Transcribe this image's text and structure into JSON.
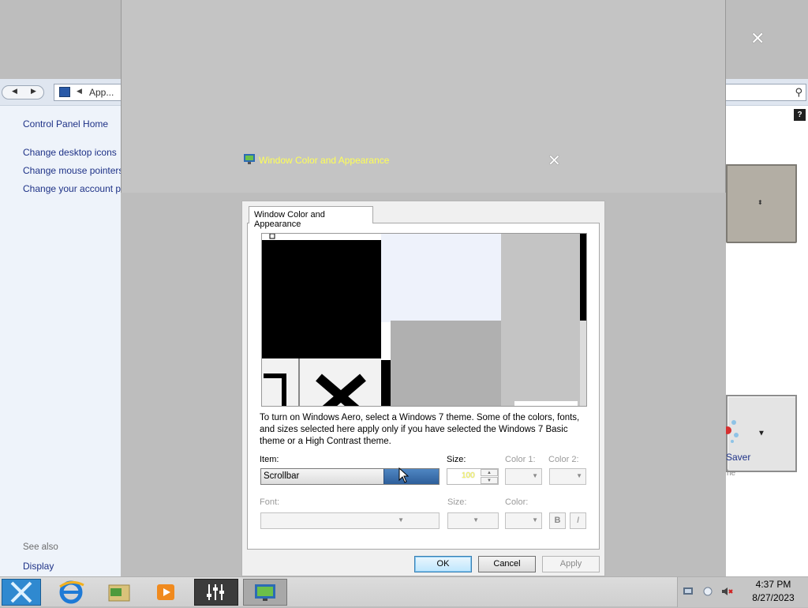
{
  "control_panel": {
    "address": "App...",
    "links": [
      "Control Panel Home",
      "Change desktop icons",
      "Change mouse pointers",
      "Change your account p"
    ],
    "see_also_heading": "See also",
    "see_also_links": [
      "Display"
    ],
    "help": "?",
    "screen_saver_label": "Saver",
    "screen_saver_sublabel": "he"
  },
  "overlay": {
    "close_glyph": "✕",
    "title": "Window Color and Appearance",
    "title_color": "#ffff55"
  },
  "dialog": {
    "tab_label": "Window Color and Appearance",
    "description": "To turn on Windows Aero, select a Windows 7 theme.  Some of the colors, fonts, and sizes selected here apply only if you have selected the Windows 7 Basic theme or a High Contrast theme.",
    "item_label": "Item:",
    "item_value": "Scrollbar",
    "size_label": "Size:",
    "size_value": "100",
    "color1_label": "Color 1:",
    "color2_label": "Color 2:",
    "font_label": "Font:",
    "font_size_label": "Size:",
    "font_color_label": "Color:",
    "bold_label": "B",
    "italic_label": "I",
    "ok_label": "OK",
    "cancel_label": "Cancel",
    "apply_label": "Apply"
  },
  "taskbar": {
    "items": [
      "start-icon",
      "internet-explorer-icon",
      "file-explorer-icon",
      "media-player-icon",
      "mixer-icon",
      "personalization-icon"
    ],
    "time": "4:37 PM",
    "date": "8/27/2023"
  }
}
